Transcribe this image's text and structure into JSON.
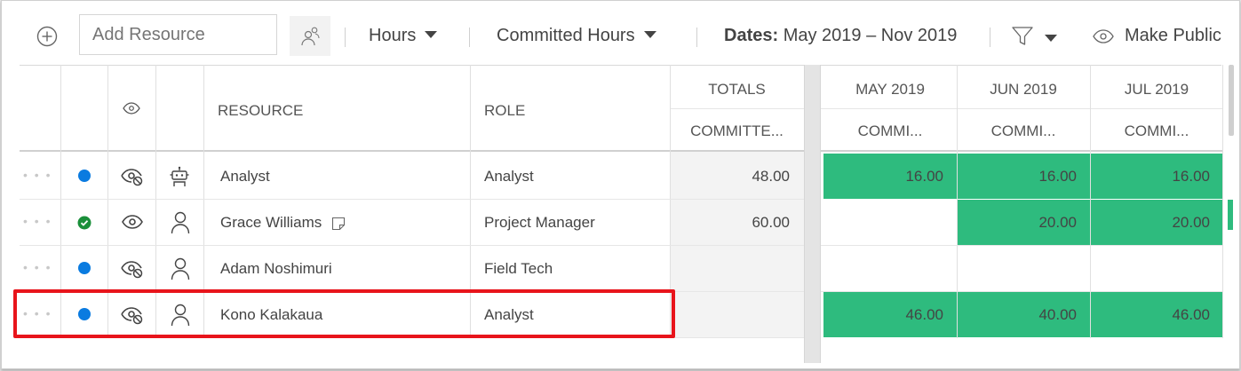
{
  "toolbar": {
    "add_resource_placeholder": "Add Resource",
    "hours_label": "Hours",
    "committed_label": "Committed Hours",
    "dates_prefix": "Dates:",
    "dates_value": "May 2019 – Nov 2019",
    "make_public_label": "Make Public"
  },
  "columns": {
    "resource": "RESOURCE",
    "role": "ROLE",
    "totals": "TOTALS",
    "totals_sub": "COMMITTE...",
    "months": [
      {
        "label": "MAY 2019",
        "sub": "COMMI..."
      },
      {
        "label": "JUN 2019",
        "sub": "COMMI..."
      },
      {
        "label": "JUL 2019",
        "sub": "COMMI..."
      }
    ]
  },
  "rows": [
    {
      "status": "blue",
      "visibility": "hidden",
      "type": "robot",
      "resource": "Analyst",
      "role": "Analyst",
      "total": "48.00",
      "months": [
        "16.00",
        "16.00",
        "16.00"
      ],
      "filled": [
        true,
        true,
        true
      ]
    },
    {
      "status": "green-check",
      "visibility": "visible",
      "type": "person",
      "resource": "Grace Williams",
      "role": "Project Manager",
      "total": "60.00",
      "months": [
        "",
        "20.00",
        "20.00"
      ],
      "filled": [
        false,
        true,
        true
      ]
    },
    {
      "status": "blue",
      "visibility": "hidden",
      "type": "person",
      "resource": "Adam Noshimuri",
      "role": "Field Tech",
      "total": "",
      "months": [
        "",
        "",
        ""
      ],
      "filled": [
        false,
        false,
        false
      ]
    },
    {
      "status": "blue",
      "visibility": "hidden",
      "type": "person",
      "resource": "Kono Kalakaua",
      "role": "Analyst",
      "total": "",
      "months": [
        "46.00",
        "40.00",
        "46.00"
      ],
      "filled": [
        true,
        true,
        true
      ]
    }
  ],
  "colors": {
    "accent_blue": "#0a7be0",
    "success_green": "#1a8f3a",
    "cell_green": "#2ebb7e",
    "highlight_red": "#e8141b"
  }
}
